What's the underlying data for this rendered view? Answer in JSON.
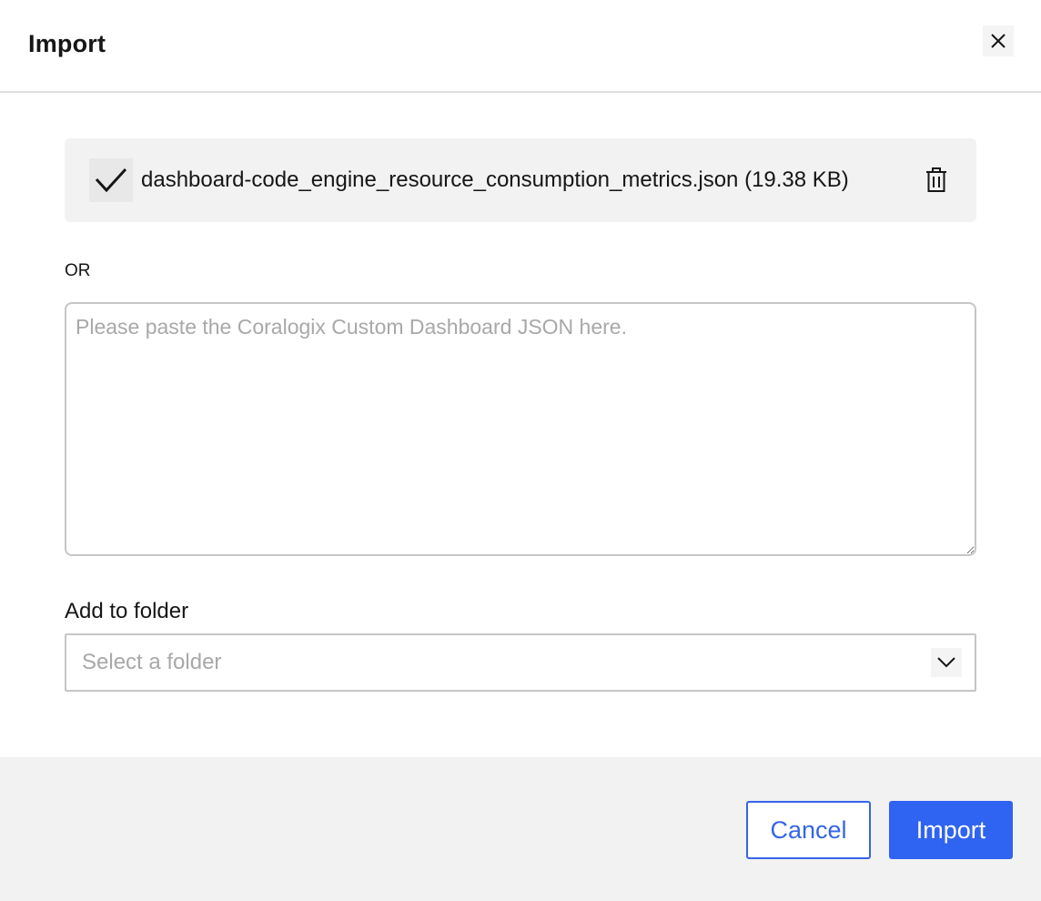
{
  "dialog": {
    "title": "Import",
    "close_icon": "close-icon"
  },
  "file": {
    "status_icon": "checkmark-icon",
    "name": "dashboard-code_engine_resource_consumption_metrics.json (19.38 KB)",
    "delete_icon": "trash-icon"
  },
  "separator_text": "OR",
  "json_input": {
    "value": "",
    "placeholder": "Please paste the Coralogix Custom Dashboard JSON here."
  },
  "folder": {
    "label": "Add to folder",
    "placeholder": "Select a folder",
    "dropdown_icon": "chevron-down-icon"
  },
  "footer": {
    "cancel_label": "Cancel",
    "import_label": "Import"
  },
  "colors": {
    "accent": "#2f63f1",
    "cancel_border": "#3565e8",
    "footer_bg": "#f2f2f2",
    "file_row_bg": "#f2f2f2"
  }
}
